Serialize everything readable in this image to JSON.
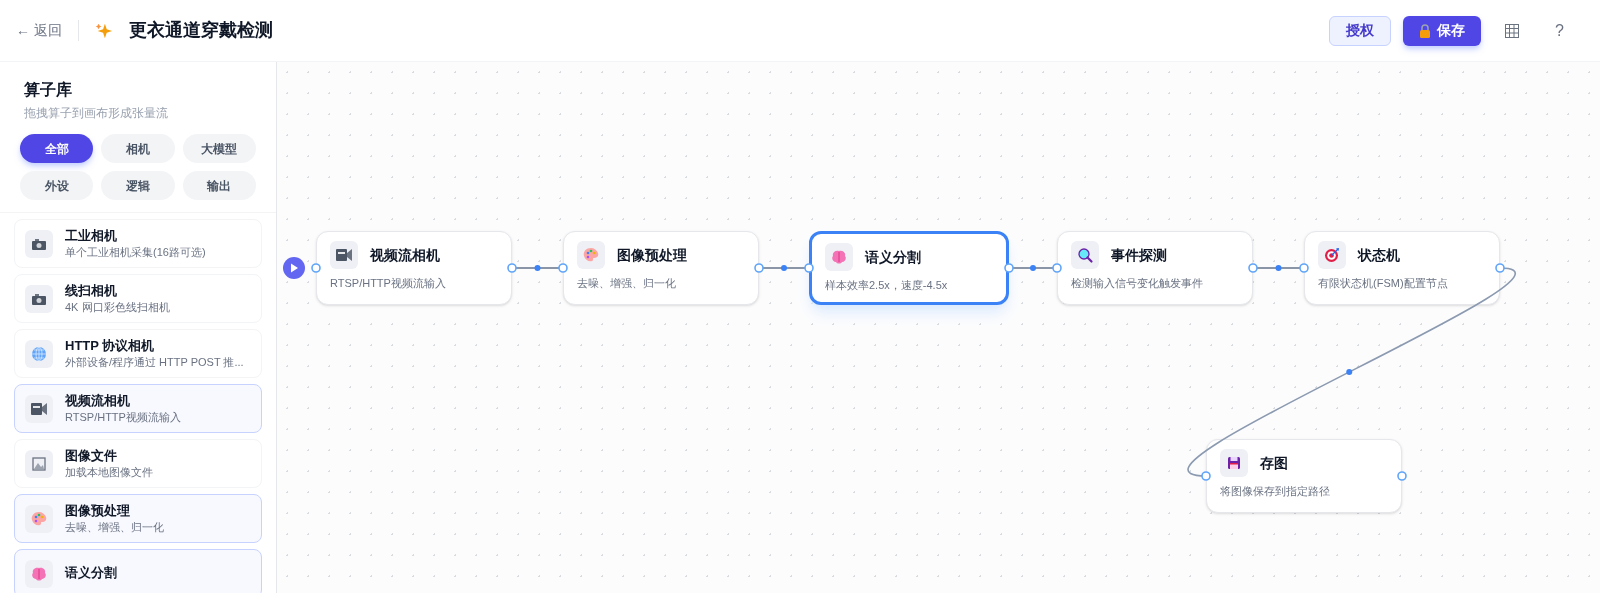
{
  "header": {
    "back": "← 返回",
    "title": "更衣通道穿戴检测",
    "buttons": [
      {
        "kind": "secondary",
        "label": "授权"
      },
      {
        "kind": "primary",
        "label": "保存"
      }
    ],
    "help": "?"
  },
  "sidebar": {
    "title": "算子库",
    "subtitle": "拖拽算子到画布形成张量流",
    "filters": [
      {
        "label": "全部",
        "selected": true
      },
      {
        "label": "相机",
        "selected": false
      },
      {
        "label": "大模型",
        "selected": false
      },
      {
        "label": "外设",
        "selected": false
      },
      {
        "label": "逻辑",
        "selected": false
      },
      {
        "label": "输出",
        "selected": false
      }
    ],
    "items": [
      {
        "kind": "camera",
        "title": "工业相机",
        "desc": "单个工业相机采集(16路可选)",
        "in_use": false
      },
      {
        "kind": "camera",
        "title": "线扫相机",
        "desc": "4K 网口彩色线扫相机",
        "in_use": false
      },
      {
        "kind": "globe",
        "title": "HTTP 协议相机",
        "desc": "外部设备/程序通过 HTTP POST 推...",
        "in_use": false
      },
      {
        "kind": "video",
        "title": "视频流相机",
        "desc": "RTSP/HTTP视频流输入",
        "in_use": true
      },
      {
        "kind": "image",
        "title": "图像文件",
        "desc": "加载本地图像文件",
        "in_use": false
      },
      {
        "kind": "palette",
        "title": "图像预处理",
        "desc": "去噪、增强、归一化",
        "in_use": true
      },
      {
        "kind": "brain",
        "title": "语义分割",
        "in_use": true
      }
    ]
  },
  "canvas": {
    "nodes": [
      {
        "kind": "video",
        "title": "视频流相机",
        "desc": "RTSP/HTTP视频流输入",
        "selected": false
      },
      {
        "kind": "palette",
        "title": "图像预处理",
        "desc": "去噪、增强、归一化",
        "selected": false
      },
      {
        "kind": "brain",
        "title": "语义分割",
        "desc": "样本效率2.5x，速度-4.5x",
        "selected": true
      },
      {
        "kind": "search",
        "title": "事件探测",
        "desc": "检测输入信号变化触发事件",
        "selected": false
      },
      {
        "kind": "target",
        "title": "状态机",
        "desc": "有限状态机(FSM)配置节点",
        "selected": false
      },
      {
        "kind": "floppy",
        "title": "存图",
        "desc": "将图像保存到指定路径",
        "selected": false
      }
    ]
  }
}
